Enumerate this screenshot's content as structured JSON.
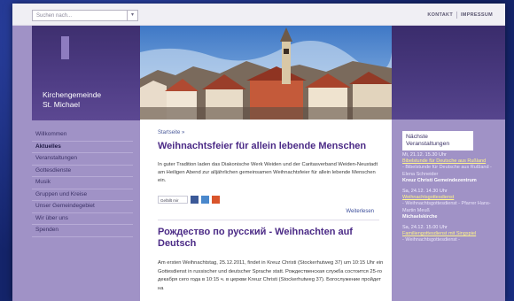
{
  "search": {
    "placeholder": "Suchen nach..."
  },
  "top_links": [
    "KONTAKT",
    "IMPRESSUM"
  ],
  "org": {
    "line1": "Kirchengemeinde",
    "line2": "St. Michael"
  },
  "nav": [
    {
      "label": "Willkommen"
    },
    {
      "label": "Aktuelles",
      "active": true
    },
    {
      "label": "Veranstaltungen"
    },
    {
      "label": "Gottesdienste"
    },
    {
      "label": "Musik"
    },
    {
      "label": "Gruppen und Kreise"
    },
    {
      "label": "Unser Gemeindegebiet"
    },
    {
      "label": "Wir über uns"
    },
    {
      "label": "Spenden"
    }
  ],
  "main": {
    "breadcrumb": "Startseite »",
    "article1": {
      "title": "Weihnachtsfeier für allein lebende Menschen",
      "body": "In guter Tradition laden das Diakonische Werk Weiden und der Caritasverband Weiden-Neustadt am Heiligen Abend zur alljährlichen gemeinsamen Weihnachtsfeier für allein lebende Menschen ein.",
      "share_label": "Gefällt mir",
      "read_more": "Weiterlesen"
    },
    "article2": {
      "title": "Рождество по русский - Weihnachten auf Deutsch",
      "body_de": "Am ersten Weihnachtstag, 25.12.2011, findet in Kreuz Christi (Stockerhutweg 37) um 10:15 Uhr ein Gottesdienst in russischer und deutscher Sprache statt.",
      "body_ru": "Рождественская служба состоится 25-го декабря сего года в 10:15 ч. в церкви Kreuz Christi (Stockerhutweg 37). Богослужение пройдет на"
    }
  },
  "events": {
    "heading": "Nächste Veranstaltungen",
    "items": [
      {
        "date": "Mi, 21.12. 15.30 Uhr",
        "title": "Bibelstunde für Deutsche aus Rußland",
        "sub": "- Bibelstunde für Deutsche aus Rußland - Elena Schneider",
        "location": "Kreuz Christi Gemeindezentrum"
      },
      {
        "date": "Sa, 24.12. 14.30 Uhr",
        "title": "Weihnachtsgottesdienst",
        "sub": "- Weihnachtsgottesdienst - Pfarrer Hans-Martin Meuß",
        "location": "Michaelskirche"
      },
      {
        "date": "Sa, 24.12. 15.00 Uhr",
        "title": "Familiengottesdienst mit Singspiel",
        "sub": "- Weihnachtsgottesdienst -",
        "location": ""
      }
    ]
  },
  "colors": {
    "purple_dark": "#4e3c84",
    "lavender": "#a092c6",
    "heading": "#4b2a86",
    "event_link": "#fff48a",
    "backdrop": "#14246a"
  }
}
